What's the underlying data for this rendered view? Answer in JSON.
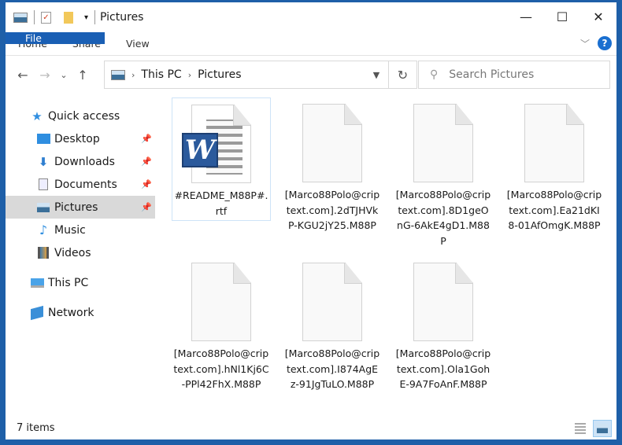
{
  "window": {
    "title": "Pictures",
    "controls": {
      "minimize": "—",
      "maximize": "☐",
      "close": "✕"
    }
  },
  "ribbon": {
    "tabs": [
      "File",
      "Home",
      "Share",
      "View"
    ],
    "help": "?"
  },
  "nav": {
    "breadcrumb": [
      "This PC",
      "Pictures"
    ],
    "search_placeholder": "Search Pictures"
  },
  "sidebar": {
    "items": [
      {
        "label": "Quick access",
        "icon": "star-icon",
        "level": 0,
        "pinned": false
      },
      {
        "label": "Desktop",
        "icon": "desktop-icon",
        "level": 1,
        "pinned": true
      },
      {
        "label": "Downloads",
        "icon": "download-icon",
        "level": 1,
        "pinned": true
      },
      {
        "label": "Documents",
        "icon": "documents-icon",
        "level": 1,
        "pinned": true
      },
      {
        "label": "Pictures",
        "icon": "pictures-icon",
        "level": 1,
        "pinned": true,
        "selected": true
      },
      {
        "label": "Music",
        "icon": "music-icon",
        "level": 1,
        "pinned": false
      },
      {
        "label": "Videos",
        "icon": "videos-icon",
        "level": 1,
        "pinned": false
      },
      {
        "label": "This PC",
        "icon": "computer-icon",
        "level": 0,
        "pinned": false
      },
      {
        "label": "Network",
        "icon": "network-icon",
        "level": 0,
        "pinned": false
      }
    ]
  },
  "files": [
    {
      "name": "#README_M88P#.rtf",
      "type": "word"
    },
    {
      "name": "[Marco88Polo@criptext.com].2dTJHVkP-KGU2jY25.M88P",
      "type": "blank"
    },
    {
      "name": "[Marco88Polo@criptext.com].8D1geOnG-6AkE4gD1.M88P",
      "type": "blank"
    },
    {
      "name": "[Marco88Polo@criptext.com].Ea21dKI8-01AfOmgK.M88P",
      "type": "blank"
    },
    {
      "name": "[Marco88Polo@criptext.com].hNl1Kj6C-PPl42FhX.M88P",
      "type": "blank"
    },
    {
      "name": "[Marco88Polo@criptext.com].I874AgEz-91JgTuLO.M88P",
      "type": "blank"
    },
    {
      "name": "[Marco88Polo@criptext.com].Ola1GohE-9A7FoAnF.M88P",
      "type": "blank"
    }
  ],
  "status": {
    "count": "7 items"
  }
}
